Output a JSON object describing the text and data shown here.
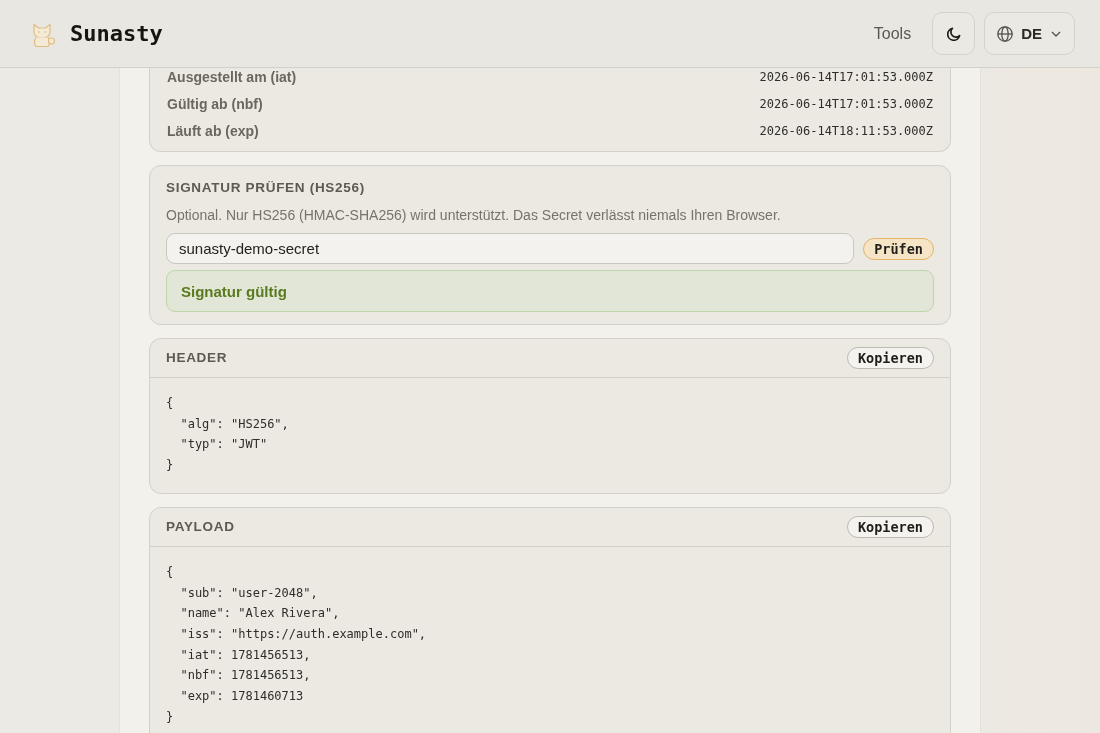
{
  "header": {
    "brand": "Sunasty",
    "nav": [
      "Tools"
    ],
    "language": "DE"
  },
  "claims": [
    {
      "label": "Ausgestellt am (iat)",
      "value": "2026-06-14T17:01:53.000Z"
    },
    {
      "label": "Gültig ab (nbf)",
      "value": "2026-06-14T17:01:53.000Z"
    },
    {
      "label": "Läuft ab (exp)",
      "value": "2026-06-14T18:11:53.000Z"
    }
  ],
  "signature": {
    "title": "SIGNATUR PRÜFEN (HS256)",
    "description": "Optional. Nur HS256 (HMAC-SHA256) wird unterstützt. Das Secret verlässt niemals Ihren Browser.",
    "secret": {
      "value": "sunasty-demo-secret"
    },
    "button": "Prüfen",
    "result": {
      "text": "Signatur gültig",
      "valid": true
    }
  },
  "sections": [
    {
      "title": "HEADER",
      "copy_button": "Kopieren",
      "code_lines": [
        "{",
        "  \"alg\": \"HS256\",",
        "  \"typ\": \"JWT\"",
        "}"
      ]
    },
    {
      "title": "PAYLOAD",
      "copy_button": "Kopieren",
      "code_lines": [
        "{",
        "  \"sub\": \"user-2048\",",
        "  \"name\": \"Alex Rivera\",",
        "  \"iss\": \"https://auth.example.com\",",
        "  \"iat\": 1781456513,",
        "  \"nbf\": 1781456513,",
        "  \"exp\": 1781460713",
        "}"
      ]
    }
  ]
}
